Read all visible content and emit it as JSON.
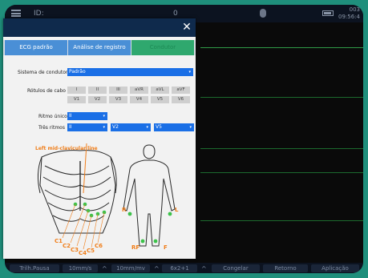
{
  "topbar": {
    "id_label": "ID:",
    "id_value": "0",
    "time_line1": "003",
    "time_line2": "09:56:4"
  },
  "bottombar": {
    "btn1": "Trilh.Pausa",
    "btn2": "10mm/s",
    "btn3": "10mm/mv",
    "btn4": "6x2+1",
    "btn5": "Congelar",
    "btn6": "Retorno",
    "btn7": "Aplicação"
  },
  "tabs": [
    {
      "label": "ECG padrão"
    },
    {
      "label": "Análise de registro"
    },
    {
      "label": "Condutor"
    }
  ],
  "form": {
    "sistema_label": "Sistema de condutor",
    "sistema_value": "Padrão",
    "rotulos_label": "Rótulos de cabo",
    "cable_row1": [
      "I",
      "II",
      "III",
      "aVR",
      "aVL",
      "aVF"
    ],
    "cable_row2": [
      "V1",
      "V2",
      "V3",
      "V4",
      "V5",
      "V6"
    ],
    "ritmo_unico_label": "Ritmo único",
    "ritmo_unico_value": "II",
    "tres_ritmos_label": "Três ritmos",
    "tres_ritmos_values": [
      "II",
      "V2",
      "V5"
    ]
  },
  "diagram": {
    "mid_clavicular": "Left mid-clavicular line",
    "chest_labels": [
      "C1",
      "C2",
      "C3",
      "C4",
      "C5",
      "C6"
    ],
    "body_labels": {
      "r": "R",
      "l": "L",
      "rf": "RF",
      "f": "F"
    },
    "electrode_color": "#3cc24a",
    "label_color": "#f07e1a"
  }
}
